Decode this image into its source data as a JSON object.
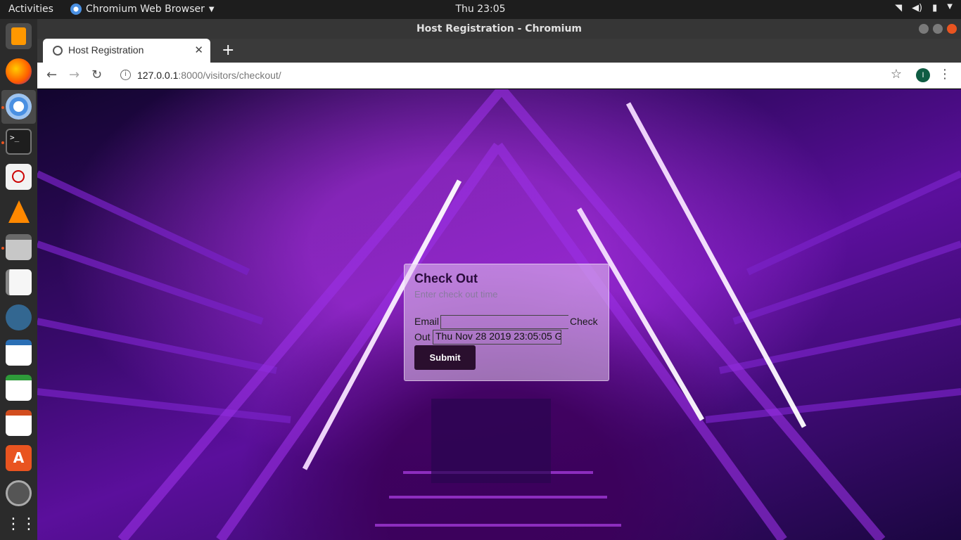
{
  "topbar": {
    "activities": "Activities",
    "app_name": "Chromium Web Browser",
    "clock": "Thu 23:05"
  },
  "window": {
    "title": "Host Registration - Chromium"
  },
  "tab": {
    "title": "Host Registration"
  },
  "address_bar": {
    "host": "127.0.0.1",
    "path": ":8000/visitors/checkout/"
  },
  "profile": {
    "initial": "I"
  },
  "form": {
    "heading": "Check Out",
    "subheading": "Enter check out time",
    "email_label": "Email",
    "email_value": "",
    "checkout_label_1": "Check",
    "checkout_label_2": "Out",
    "checkout_value": "Thu Nov 28 2019 23:05:05 G",
    "submit_label": "Submit"
  },
  "dock": {
    "items": [
      "sublime-text-icon",
      "firefox-icon",
      "chromium-icon",
      "terminal-icon",
      "evince-icon",
      "vlc-icon",
      "files-icon",
      "text-editor-icon",
      "pgadmin-icon",
      "writer-icon",
      "calc-icon",
      "impress-icon",
      "software-center-icon",
      "updater-icon",
      "show-apps-icon"
    ]
  },
  "colors": {
    "accent": "#e95420",
    "card_bg": "#e6c8f0",
    "button_bg": "#2a0f2e"
  }
}
